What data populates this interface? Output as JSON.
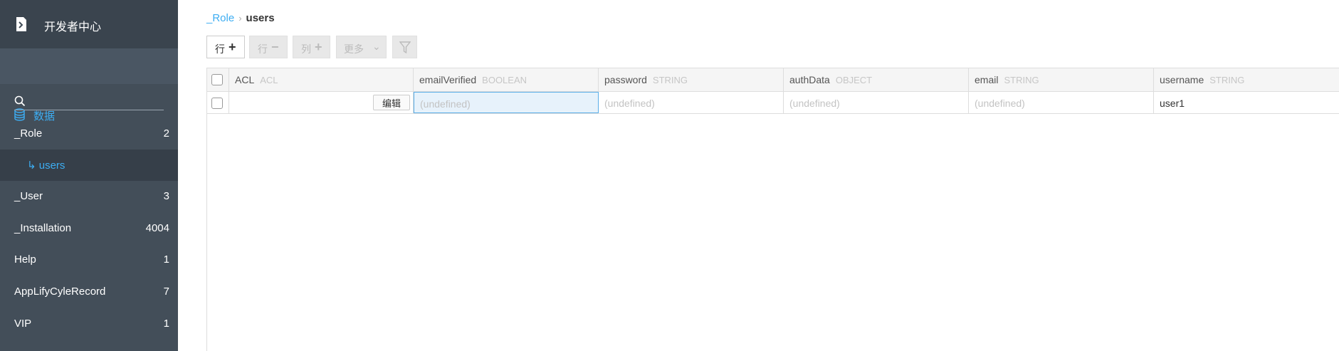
{
  "sidebar": {
    "app_title": "开发者中心",
    "section_label": "数据",
    "search_placeholder": "",
    "items": [
      {
        "label": "_Role",
        "count": "2"
      },
      {
        "label": "↳ users",
        "count": ""
      },
      {
        "label": "_User",
        "count": "3"
      },
      {
        "label": "_Installation",
        "count": "4004"
      },
      {
        "label": "Help",
        "count": "1"
      },
      {
        "label": "AppLifyCyleRecord",
        "count": "7"
      },
      {
        "label": "VIP",
        "count": "1"
      }
    ]
  },
  "breadcrumb": {
    "parent": "_Role",
    "separator": "›",
    "current": "users"
  },
  "toolbar": {
    "add_row_label": "行",
    "add_row_glyph": "+",
    "remove_row_label": "行",
    "remove_row_glyph": "−",
    "add_col_label": "列",
    "add_col_glyph": "+",
    "more_label": "更多",
    "more_glyph": "⌄"
  },
  "grid": {
    "columns": [
      {
        "name": "ACL",
        "type": "ACL"
      },
      {
        "name": "emailVerified",
        "type": "BOOLEAN"
      },
      {
        "name": "password",
        "type": "STRING"
      },
      {
        "name": "authData",
        "type": "OBJECT"
      },
      {
        "name": "email",
        "type": "STRING"
      },
      {
        "name": "username",
        "type": "STRING"
      }
    ],
    "rows": [
      {
        "acl_edit_label": "编辑",
        "emailVerified": "(undefined)",
        "password": "(undefined)",
        "authData": "(undefined)",
        "email": "(undefined)",
        "username": "user1"
      }
    ]
  },
  "colors": {
    "sidebar_bg": "#434e59",
    "accent": "#3dadf2"
  }
}
